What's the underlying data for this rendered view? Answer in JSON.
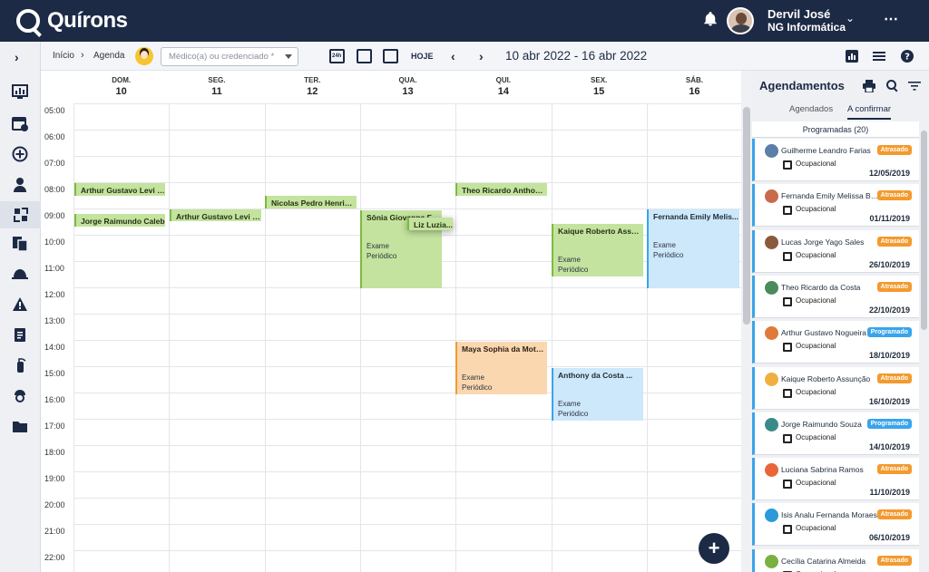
{
  "app": {
    "name": "Quírons"
  },
  "user": {
    "name": "Dervil José",
    "company": "NG Informática"
  },
  "breadcrumb": {
    "home": "Início",
    "current": "Agenda"
  },
  "search": {
    "placeholder": "Médico(a) ou credenciado *"
  },
  "toolbar": {
    "today_label": "HOJE",
    "date_range": "10 abr 2022 - 16 abr 2022",
    "icon_24h": "24h"
  },
  "days": [
    {
      "name": "DOM.",
      "num": "10"
    },
    {
      "name": "SEG.",
      "num": "11"
    },
    {
      "name": "TER.",
      "num": "12"
    },
    {
      "name": "QUA.",
      "num": "13"
    },
    {
      "name": "QUI.",
      "num": "14"
    },
    {
      "name": "SEX.",
      "num": "15"
    },
    {
      "name": "SÁB.",
      "num": "16"
    }
  ],
  "hours": [
    "05:00",
    "06:00",
    "07:00",
    "08:00",
    "09:00",
    "10:00",
    "11:00",
    "12:00",
    "13:00",
    "14:00",
    "15:00",
    "16:00",
    "17:00",
    "18:00",
    "19:00",
    "20:00",
    "21:00",
    "22:00"
  ],
  "events": [
    {
      "title": "Arthur Gustavo Levi N...",
      "color": "green"
    },
    {
      "title": "Jorge Raimundo Caleb",
      "color": "green"
    },
    {
      "title": "Arthur Gustavo Levi N...",
      "color": "green"
    },
    {
      "title": "Nicolas Pedro Henriqu...",
      "color": "green"
    },
    {
      "title": "Sônia Giovanna Far...",
      "line1": "Exame",
      "line2": "Periódico",
      "color": "green"
    },
    {
      "title": "Liz Luzia...",
      "color": "green"
    },
    {
      "title": "Theo Ricardo Anthony...",
      "color": "green"
    },
    {
      "title": "Maya Sophia da Mota ...",
      "line1": "Exame",
      "line2": "Periódico",
      "color": "orange"
    },
    {
      "title": "Kaique Roberto Assu ...",
      "line1": "Exame",
      "line2": "Periódico",
      "color": "green"
    },
    {
      "title": "Anthony da Costa ...",
      "line1": "Exame",
      "line2": "Periódico",
      "color": "blue"
    },
    {
      "title": "Fernanda Emily Melis...",
      "line1": "Exame",
      "line2": "Periódico",
      "color": "blue"
    }
  ],
  "panel": {
    "title": "Agendamentos",
    "tabs": [
      "Agendados",
      "A confirmar"
    ],
    "section": "Programadas (20)",
    "cards": [
      {
        "name": "Guilherme Leandro Farias",
        "badge": "Atrasado",
        "type": "Ocupacional",
        "date": "12/05/2019",
        "avatar_color": "#5a7fa8"
      },
      {
        "name": "Fernanda Emily Melissa Ber...",
        "badge": "Atrasado",
        "type": "Ocupacional",
        "date": "01/11/2019",
        "avatar_color": "#c96a4a"
      },
      {
        "name": "Lucas Jorge Yago Sales",
        "badge": "Atrasado",
        "type": "Ocupacional",
        "date": "26/10/2019",
        "avatar_color": "#8a5a3c"
      },
      {
        "name": "Theo Ricardo da Costa",
        "badge": "Atrasado",
        "type": "Ocupacional",
        "date": "22/10/2019",
        "avatar_color": "#4a8a5c"
      },
      {
        "name": "Arthur Gustavo Nogueira",
        "badge": "Programado",
        "type": "Ocupacional",
        "date": "18/10/2019",
        "avatar_color": "#e07a3a"
      },
      {
        "name": "Kaique Roberto Assunção",
        "badge": "Atrasado",
        "type": "Ocupacional",
        "date": "16/10/2019",
        "avatar_color": "#f0b040"
      },
      {
        "name": "Jorge Raimundo Souza",
        "badge": "Programado",
        "type": "Ocupacional",
        "date": "14/10/2019",
        "avatar_color": "#3a8a8a"
      },
      {
        "name": "Luciana Sabrina Ramos",
        "badge": "Atrasado",
        "type": "Ocupacional",
        "date": "11/10/2019",
        "avatar_color": "#e8663a"
      },
      {
        "name": "Isis Analu Fernanda Moraes",
        "badge": "Atrasado",
        "type": "Ocupacional",
        "date": "06/10/2019",
        "avatar_color": "#2a9ad8"
      },
      {
        "name": "Cecília Catarina Almeida",
        "badge": "Atrasado",
        "type": "Ocupacional",
        "date": "",
        "avatar_color": "#7ab040"
      }
    ]
  },
  "colors": {
    "navy": "#1d2a45",
    "late": "#f39a2e",
    "scheduled": "#3aa4ea",
    "event_green": "#c4e39e",
    "event_blue": "#cde8fa",
    "event_orange": "#fbd7b0"
  }
}
